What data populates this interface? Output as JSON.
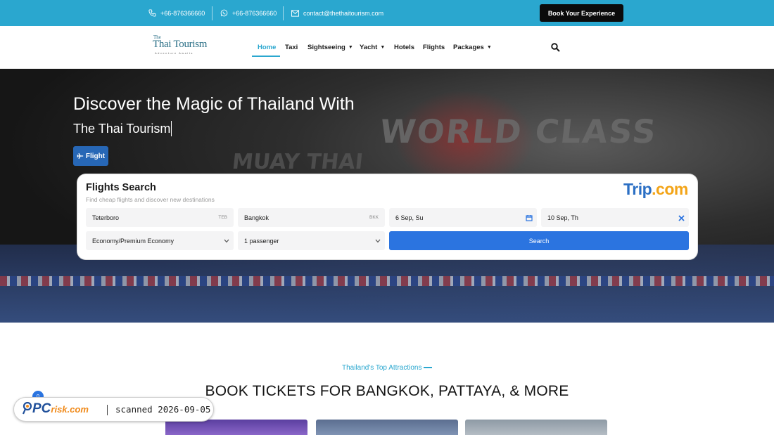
{
  "topbar": {
    "phone": "+66-876366660",
    "whatsapp": "+66-876366660",
    "email": "contact@thethaitourism.com",
    "cta_label": "Book Your Experience",
    "bg_color": "#2aa7cf"
  },
  "nav": {
    "logo": {
      "line1": "The",
      "line2": "Thai Tourism",
      "tagline": "Adventure Awaits"
    },
    "items": [
      {
        "label": "Home",
        "active": true,
        "dropdown": false
      },
      {
        "label": "Taxi",
        "active": false,
        "dropdown": false
      },
      {
        "label": "Sightseeing",
        "active": false,
        "dropdown": true
      },
      {
        "label": "Yacht",
        "active": false,
        "dropdown": true
      },
      {
        "label": "Hotels",
        "active": false,
        "dropdown": false
      },
      {
        "label": "Flights",
        "active": false,
        "dropdown": false
      },
      {
        "label": "Packages",
        "active": false,
        "dropdown": true
      }
    ],
    "search_icon": "search-icon"
  },
  "hero": {
    "title": "Discover the Magic of Thailand With",
    "subtitle": "The Thai Tourism",
    "tab_label": "Flight",
    "background_sign": "WORLD CLASS",
    "background_sign2": "MUAY THAI"
  },
  "flight_widget": {
    "title": "Flights Search",
    "subtitle": "Find cheap flights and discover new destinations",
    "brand": "Trip",
    "brand_suffix": ".com",
    "from": {
      "value": "Teterboro",
      "code": "TEB"
    },
    "to": {
      "value": "Bangkok",
      "code": "BKK"
    },
    "depart": "6 Sep, Su",
    "return": "10 Sep, Th",
    "cabin": "Economy/Premium Economy",
    "passengers": "1 passenger",
    "search_label": "Search",
    "accent": "#2b74e0"
  },
  "section": {
    "tag": "Thailand's Top Attractions",
    "title": "BOOK TICKETS FOR BANGKOK, PATTAYA, & MORE"
  },
  "overlay": {
    "badge": "0",
    "logo_pc": "PC",
    "logo_risk": "risk.com",
    "scan_text": "scanned 2026-09-05"
  }
}
